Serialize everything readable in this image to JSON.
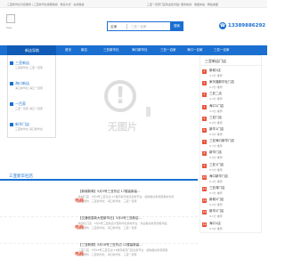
{
  "topbar": {
    "left_text": "三亚新华社为您服务 | 三亚新华社客服热线 · 联系方式 · 在线留言",
    "right_text": "三亚一百家门店欢迎您光临! 服务热线 · 收藏本站 · 网站地图"
  },
  "logo": {
    "label": "logo"
  },
  "search": {
    "category": "店铺",
    "placeholder": "三亚一百家",
    "button_label": "搜索"
  },
  "contact": {
    "phone": "13389886292"
  },
  "nav": {
    "all_label": "新店导航",
    "items": [
      "首页",
      "新店",
      "三亚新华社",
      "海口新华社",
      "三亚一百家",
      "海口一百家",
      "三亚一百家"
    ]
  },
  "sidebar": {
    "items": [
      {
        "label": "三亚新店",
        "sub": "三亚新华社 三亚一百家"
      },
      {
        "label": "海口新店",
        "sub": "海口新华社 海口一百家"
      },
      {
        "label": "一百家",
        "sub": "三亚一百家 海口一百家"
      },
      {
        "label": "新华门店",
        "sub": "三亚新华社 海口新华社"
      }
    ]
  },
  "banner": {
    "placeholder_text": "无图片"
  },
  "right_panel": {
    "title": "三亚新店门店",
    "items": [
      {
        "num": "1",
        "name": "新城1店",
        "stat": "9.5分 推荐"
      },
      {
        "num": "2",
        "name": "家乐福新华社门店",
        "stat": "9.3分 推荐"
      },
      {
        "num": "3",
        "name": "三亚二店",
        "stat": "9.2分 推荐"
      },
      {
        "num": "4",
        "name": "海口1门店",
        "stat": "9.0分 推荐"
      },
      {
        "num": "5",
        "name": "三亚门店",
        "stat": "8.9分 推荐"
      },
      {
        "num": "6",
        "name": "新华1门店",
        "stat": "8.8分 推荐"
      },
      {
        "num": "7",
        "name": "三亚海口新华门店",
        "stat": "8.7分 推荐"
      },
      {
        "num": "8",
        "name": "新华门店",
        "stat": "8.6分 推荐"
      },
      {
        "num": "9",
        "name": "三亚1门店",
        "stat": "8.5分 推荐"
      },
      {
        "num": "10",
        "name": "海口新华门店",
        "stat": "8.4分 推荐"
      },
      {
        "num": "11",
        "name": "三亚湾门店",
        "stat": "8.3分 推荐"
      },
      {
        "num": "12",
        "name": "新城1门店",
        "stat": "8.2分 推荐"
      },
      {
        "num": "13",
        "name": "新华2门店",
        "stat": "8.1分 推荐"
      },
      {
        "num": "14",
        "name": "海口1店",
        "stat": "8.0分 推荐"
      }
    ]
  },
  "section": {
    "title": "三亚新华社店"
  },
  "news": [
    {
      "title": "【新城新闻】5月3号三亚东边 17楼高新高...",
      "desc": "新城门店 · 5月3号三亚东边 17楼高新高新店全新开业 · 感谢各位新老顾客的支持",
      "desc2": "电话预约 · 三亚新华社 · 海口新华社 · 三亚一百家",
      "tag": "电商"
    },
    {
      "title": "【交通信息新大型新华社】5月4号三亚新店...",
      "desc": "新华社门店 · 5月4号三亚新店大型新华社即将开业 · 欢迎各位新老顾客光临",
      "desc2": "电话预约 · 三亚新华社 · 海口新华社 · 三亚一百家",
      "tag": "电商"
    },
    {
      "title": "【三亚新闻】5月18号三亚东边 12楼高新高...",
      "desc": "三亚门店 · 5月18号三亚东边 12楼高新高门店全新开业 · 感谢各位新老顾客",
      "desc2": "电话预约 · 三亚新华社 · 海口新华社 · 三亚一百家",
      "tag": "电商"
    }
  ]
}
